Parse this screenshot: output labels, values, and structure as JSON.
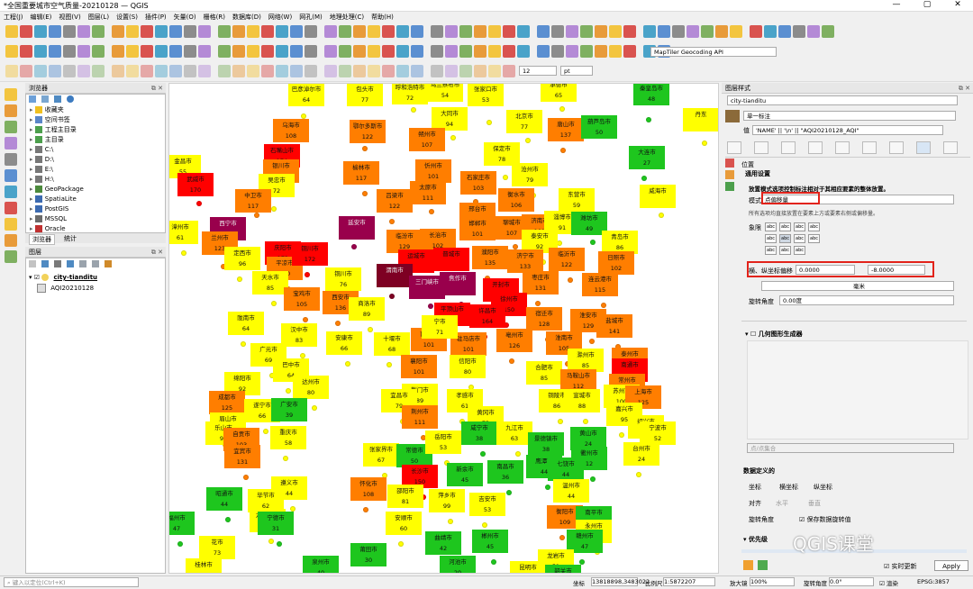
{
  "window": {
    "title": "*全国重要城市空气质量-20210128 — QGIS"
  },
  "menu": [
    "工程(J)",
    "编辑(E)",
    "视图(V)",
    "图层(L)",
    "设置(S)",
    "插件(P)",
    "矢量(O)",
    "栅格(R)",
    "数据库(D)",
    "网络(W)",
    "网孔(M)",
    "地理处理(C)",
    "帮助(H)"
  ],
  "toolbar": {
    "geocoder": "MapTiler Geocoding API",
    "size_value": "12",
    "size_unit": "pt"
  },
  "browser": {
    "title": "浏览器",
    "items": [
      "收藏夹",
      "空间书签",
      "工程主目录",
      "主目录",
      "C:\\",
      "D:\\",
      "E:\\",
      "H:\\",
      "GeoPackage",
      "SpatiaLite",
      "PostGIS",
      "MSSQL",
      "Oracle"
    ],
    "tabs": [
      "浏览器",
      "统计"
    ]
  },
  "layers": {
    "title": "图层",
    "items": [
      "city-tianditu",
      "AQI20210128"
    ]
  },
  "style_panel": {
    "title": "图层样式",
    "layer": "city-tianditu",
    "renderer": "单一标注",
    "value": "'NAME' || '\\n' || \"AQI20210128_AQI\"",
    "section_position": "位置",
    "section_general": "通用设置",
    "desc": "放置模式选项控制标注相对于其相应要素的整体放置。",
    "mode_label": "模式",
    "mode_value": "点偏移量",
    "hint": "所有选项均直接放置在要素上方或要素右侧或偏移量。",
    "quadrant_label": "象限",
    "offset_label": "横、纵坐标偏移",
    "offset_x": "0.0000",
    "offset_y": "-8.0000",
    "unit": "毫米",
    "rotation_label": "旋转角度",
    "rotation_value": "0.00度",
    "geom_gen": "几何图形生成器",
    "point_cluster": "点/点集合",
    "data_defined": "数据定义的",
    "coord_label": "坐标",
    "x_label": "横坐标",
    "y_label": "纵坐标",
    "align_label": "对齐",
    "h_label": "水平",
    "v_label": "垂直",
    "rot_label": "旋转角度",
    "keep_rot": "保存数据旋转值",
    "priority": "优先级",
    "live_update": "实时更新",
    "apply": "Apply"
  },
  "watermark": "QGIS课堂",
  "status": {
    "search_placeholder": "键入以定位(Ctrl+K)",
    "coord_label": "坐标",
    "coord_value": "13818898,3483022",
    "scale_label": "比例尺",
    "scale_value": "1:5872207",
    "mag_label": "放大镜",
    "mag_value": "100%",
    "rot_label": "旋转角度",
    "rot_value": "0.0°",
    "render_label": "渲染",
    "crs": "EPSG:3857"
  },
  "colors": {
    "good": "#1ec61e",
    "moderate": "#ffff00",
    "usg": "#ff7e00",
    "unhealthy": "#ff0000",
    "very": "#99004c",
    "hazardous": "#7e0023",
    "panel_border": "#bcbcbc",
    "highlight": "#e2231a"
  },
  "cities": [
    {
      "name": "巴彦淖尔市",
      "aqi": "64",
      "c": "moderate"
    },
    {
      "name": "包头市",
      "aqi": "77",
      "c": "moderate"
    },
    {
      "name": "呼和浩特市",
      "aqi": "72",
      "c": "moderate"
    },
    {
      "name": "乌兰察布市",
      "aqi": "54",
      "c": "moderate"
    },
    {
      "name": "张家口市",
      "aqi": "53",
      "c": "moderate"
    },
    {
      "name": "承德市",
      "aqi": "65",
      "c": "moderate"
    },
    {
      "name": "秦皇岛市",
      "aqi": "48",
      "c": "good"
    },
    {
      "name": "丹东",
      "aqi": "",
      "c": "moderate"
    },
    {
      "name": "北京市",
      "aqi": "77",
      "c": "moderate"
    },
    {
      "name": "唐山市",
      "aqi": "137",
      "c": "usg"
    },
    {
      "name": "葫芦岛市",
      "aqi": "50",
      "c": "good"
    },
    {
      "name": "乌海市",
      "aqi": "108",
      "c": "usg"
    },
    {
      "name": "鄂尔多斯市",
      "aqi": "122",
      "c": "usg"
    },
    {
      "name": "大同市",
      "aqi": "94",
      "c": "moderate"
    },
    {
      "name": "朔州市",
      "aqi": "107",
      "c": "usg"
    },
    {
      "name": "大连市",
      "aqi": "27",
      "c": "good"
    },
    {
      "name": "石嘴山市",
      "aqi": "174",
      "c": "unhealthy"
    },
    {
      "name": "保定市",
      "aqi": "78",
      "c": "moderate"
    },
    {
      "name": "银川市",
      "aqi": "109",
      "c": "usg"
    },
    {
      "name": "榆林市",
      "aqi": "117",
      "c": "usg"
    },
    {
      "name": "忻州市",
      "aqi": "101",
      "c": "usg"
    },
    {
      "name": "石家庄市",
      "aqi": "103",
      "c": "usg"
    },
    {
      "name": "沧州市",
      "aqi": "79",
      "c": "moderate"
    },
    {
      "name": "金昌市",
      "aqi": "55",
      "c": "moderate"
    },
    {
      "name": "吴忠市",
      "aqi": "72",
      "c": "moderate"
    },
    {
      "name": "武威市",
      "aqi": "170",
      "c": "unhealthy"
    },
    {
      "name": "中卫市",
      "aqi": "117",
      "c": "usg"
    },
    {
      "name": "吕梁市",
      "aqi": "122",
      "c": "usg"
    },
    {
      "name": "太原市",
      "aqi": "111",
      "c": "usg"
    },
    {
      "name": "衡水市",
      "aqi": "106",
      "c": "usg"
    },
    {
      "name": "东营市",
      "aqi": "59",
      "c": "moderate"
    },
    {
      "name": "威海市",
      "aqi": "",
      "c": "moderate"
    },
    {
      "name": "邢台市",
      "aqi": "111",
      "c": "usg"
    },
    {
      "name": "邯郸市",
      "aqi": "101",
      "c": "usg"
    },
    {
      "name": "聊城市",
      "aqi": "107",
      "c": "usg"
    },
    {
      "name": "济南市",
      "aqi": "101",
      "c": "usg"
    },
    {
      "name": "淄博市",
      "aqi": "91",
      "c": "moderate"
    },
    {
      "name": "潍坊市",
      "aqi": "49",
      "c": "good"
    },
    {
      "name": "西宁市",
      "aqi": "",
      "c": "very"
    },
    {
      "name": "延安市",
      "aqi": "",
      "c": "very"
    },
    {
      "name": "兰州市",
      "aqi": "123",
      "c": "usg"
    },
    {
      "name": "临汾市",
      "aqi": "129",
      "c": "usg"
    },
    {
      "name": "长治市",
      "aqi": "102",
      "c": "usg"
    },
    {
      "name": "泰安市",
      "aqi": "92",
      "c": "moderate"
    },
    {
      "name": "青岛市",
      "aqi": "86",
      "c": "moderate"
    },
    {
      "name": "定西市",
      "aqi": "96",
      "c": "moderate"
    },
    {
      "name": "庆阳市",
      "aqi": "172",
      "c": "unhealthy"
    },
    {
      "name": "平凉市",
      "aqi": "120",
      "c": "usg"
    },
    {
      "name": "铜川市",
      "aqi": "172",
      "c": "unhealthy"
    },
    {
      "name": "运城市",
      "aqi": "",
      "c": "unhealthy"
    },
    {
      "name": "晋城市",
      "aqi": "",
      "c": "unhealthy"
    },
    {
      "name": "濮阳市",
      "aqi": "135",
      "c": "usg"
    },
    {
      "name": "济宁市",
      "aqi": "133",
      "c": "usg"
    },
    {
      "name": "临沂市",
      "aqi": "122",
      "c": "usg"
    },
    {
      "name": "日照市",
      "aqi": "102",
      "c": "usg"
    },
    {
      "name": "天水市",
      "aqi": "85",
      "c": "moderate"
    },
    {
      "name": "铜川市",
      "aqi": "76",
      "c": "moderate"
    },
    {
      "name": "渭南市",
      "aqi": "",
      "c": "hazardous"
    },
    {
      "name": "三门峡市",
      "aqi": "",
      "c": "very"
    },
    {
      "name": "焦作市",
      "aqi": "",
      "c": "very"
    },
    {
      "name": "枣庄市",
      "aqi": "131",
      "c": "usg"
    },
    {
      "name": "连云港市",
      "aqi": "115",
      "c": "usg"
    },
    {
      "name": "宝鸡市",
      "aqi": "105",
      "c": "usg"
    },
    {
      "name": "西安市",
      "aqi": "136",
      "c": "usg"
    },
    {
      "name": "商洛市",
      "aqi": "89",
      "c": "moderate"
    },
    {
      "name": "开封市",
      "aqi": "",
      "c": "unhealthy"
    },
    {
      "name": "徐州市",
      "aqi": "150",
      "c": "unhealthy"
    },
    {
      "name": "宿迁市",
      "aqi": "128",
      "c": "usg"
    },
    {
      "name": "平顶山市",
      "aqi": "169",
      "c": "unhealthy"
    },
    {
      "name": "许昌市",
      "aqi": "164",
      "c": "unhealthy"
    },
    {
      "name": "淮安市",
      "aqi": "129",
      "c": "usg"
    },
    {
      "name": "盐城市",
      "aqi": "141",
      "c": "usg"
    },
    {
      "name": "陇南市",
      "aqi": "64",
      "c": "moderate"
    },
    {
      "name": "汉中市",
      "aqi": "83",
      "c": "moderate"
    },
    {
      "name": "安康市",
      "aqi": "66",
      "c": "moderate"
    },
    {
      "name": "十堰市",
      "aqi": "68",
      "c": "moderate"
    },
    {
      "name": "南阳市",
      "aqi": "101",
      "c": "usg"
    },
    {
      "name": "驻马店市",
      "aqi": "101",
      "c": "usg"
    },
    {
      "name": "亳州市",
      "aqi": "126",
      "c": "usg"
    },
    {
      "name": "淮南市",
      "aqi": "105",
      "c": "usg"
    },
    {
      "name": "广元市",
      "aqi": "69",
      "c": "moderate"
    },
    {
      "name": "巴中市",
      "aqi": "64",
      "c": "moderate"
    },
    {
      "name": "襄阳市",
      "aqi": "101",
      "c": "usg"
    },
    {
      "name": "信阳市",
      "aqi": "80",
      "c": "moderate"
    },
    {
      "name": "滁州市",
      "aqi": "85",
      "c": "moderate"
    },
    {
      "name": "泰州市",
      "aqi": "139",
      "c": "usg"
    },
    {
      "name": "南通市",
      "aqi": "",
      "c": "unhealthy"
    },
    {
      "name": "绵阳市",
      "aqi": "92",
      "c": "moderate"
    },
    {
      "name": "达州市",
      "aqi": "80",
      "c": "moderate"
    },
    {
      "name": "合肥市",
      "aqi": "85",
      "c": "moderate"
    },
    {
      "name": "马鞍山市",
      "aqi": "112",
      "c": "usg"
    },
    {
      "name": "常州市",
      "aqi": "124",
      "c": "usg"
    },
    {
      "name": "苏州市",
      "aqi": "100",
      "c": "moderate"
    },
    {
      "name": "上海市",
      "aqi": "125",
      "c": "usg"
    },
    {
      "name": "荆门市",
      "aqi": "89",
      "c": "moderate"
    },
    {
      "name": "宜昌市",
      "aqi": "79",
      "c": "moderate"
    },
    {
      "name": "孝感市",
      "aqi": "61",
      "c": "moderate"
    },
    {
      "name": "铜陵市",
      "aqi": "86",
      "c": "moderate"
    },
    {
      "name": "宣城市",
      "aqi": "88",
      "c": "moderate"
    },
    {
      "name": "嘉兴市",
      "aqi": "95",
      "c": "moderate"
    },
    {
      "name": "成都市",
      "aqi": "125",
      "c": "usg"
    },
    {
      "name": "遂宁市",
      "aqi": "66",
      "c": "moderate"
    },
    {
      "name": "广安市",
      "aqi": "39",
      "c": "good"
    },
    {
      "name": "荆州市",
      "aqi": "111",
      "c": "usg"
    },
    {
      "name": "黄冈市",
      "aqi": "73",
      "c": "moderate"
    },
    {
      "name": "眉山市",
      "aqi": "95",
      "c": "moderate"
    },
    {
      "name": "乐山市",
      "aqi": "94",
      "c": "moderate"
    },
    {
      "name": "自贡市",
      "aqi": "103",
      "c": "usg"
    },
    {
      "name": "重庆市",
      "aqi": "58",
      "c": "moderate"
    },
    {
      "name": "咸宁市",
      "aqi": "38",
      "c": "good"
    },
    {
      "name": "九江市",
      "aqi": "63",
      "c": "moderate"
    },
    {
      "name": "景德镇市",
      "aqi": "38",
      "c": "good"
    },
    {
      "name": "黄山市",
      "aqi": "24",
      "c": "good"
    },
    {
      "name": "绍兴市",
      "aqi": "65",
      "c": "moderate"
    },
    {
      "name": "宁波市",
      "aqi": "52",
      "c": "moderate"
    },
    {
      "name": "宜宾市",
      "aqi": "131",
      "c": "usg"
    },
    {
      "name": "张家界市",
      "aqi": "67",
      "c": "moderate"
    },
    {
      "name": "常德市",
      "aqi": "50",
      "c": "good"
    },
    {
      "name": "岳阳市",
      "aqi": "53",
      "c": "moderate"
    },
    {
      "name": "衢州市",
      "aqi": "12",
      "c": "good"
    },
    {
      "name": "台州市",
      "aqi": "24",
      "c": "moderate"
    },
    {
      "name": "遵义市",
      "aqi": "44",
      "c": "moderate"
    },
    {
      "name": "长沙市",
      "aqi": "150",
      "c": "unhealthy"
    },
    {
      "name": "新余市",
      "aqi": "45",
      "c": "good"
    },
    {
      "name": "南昌市",
      "aqi": "36",
      "c": "good"
    },
    {
      "name": "鹰潭市",
      "aqi": "44",
      "c": "good"
    },
    {
      "name": "七饶市",
      "aqi": "44",
      "c": "good"
    },
    {
      "name": "温州市",
      "aqi": "44",
      "c": "moderate"
    },
    {
      "name": "毕节市",
      "aqi": "62",
      "c": "moderate"
    },
    {
      "name": "怀化市",
      "aqi": "108",
      "c": "usg"
    },
    {
      "name": "邵阳市",
      "aqi": "81",
      "c": "moderate"
    },
    {
      "name": "萍乡市",
      "aqi": "99",
      "c": "moderate"
    },
    {
      "name": "吉安市",
      "aqi": "53",
      "c": "moderate"
    },
    {
      "name": "昭通市",
      "aqi": "44",
      "c": "good"
    },
    {
      "name": "六盘水市",
      "aqi": "52",
      "c": "moderate"
    },
    {
      "name": "衡阳市",
      "aqi": "109",
      "c": "usg"
    },
    {
      "name": "南平市",
      "aqi": "15",
      "c": "good"
    },
    {
      "name": "宁德市",
      "aqi": "31",
      "c": "good"
    },
    {
      "name": "安顺市",
      "aqi": "60",
      "c": "moderate"
    },
    {
      "name": "永州市",
      "aqi": "82",
      "c": "moderate"
    },
    {
      "name": "福州市",
      "aqi": "47",
      "c": "good"
    },
    {
      "name": "花市",
      "aqi": "73",
      "c": "moderate"
    },
    {
      "name": "曲靖市",
      "aqi": "42",
      "c": "good"
    },
    {
      "name": "郴州市",
      "aqi": "45",
      "c": "good"
    },
    {
      "name": "赣州市",
      "aqi": "47",
      "c": "good"
    },
    {
      "name": "莆田市",
      "aqi": "30",
      "c": "good"
    },
    {
      "name": "桂林市",
      "aqi": "56",
      "c": "moderate"
    },
    {
      "name": "昆明市",
      "aqi": "73",
      "c": "moderate"
    },
    {
      "name": "龙岩市",
      "aqi": "51",
      "c": "moderate"
    },
    {
      "name": "泉州市",
      "aqi": "40",
      "c": "good"
    },
    {
      "name": "河池市",
      "aqi": "20",
      "c": "good"
    },
    {
      "name": "韶关市",
      "aqi": "27",
      "c": "good"
    },
    {
      "name": "漳州市",
      "aqi": "61",
      "c": "moderate"
    },
    {
      "name": "宁市",
      "aqi": "71",
      "c": "moderate"
    }
  ]
}
